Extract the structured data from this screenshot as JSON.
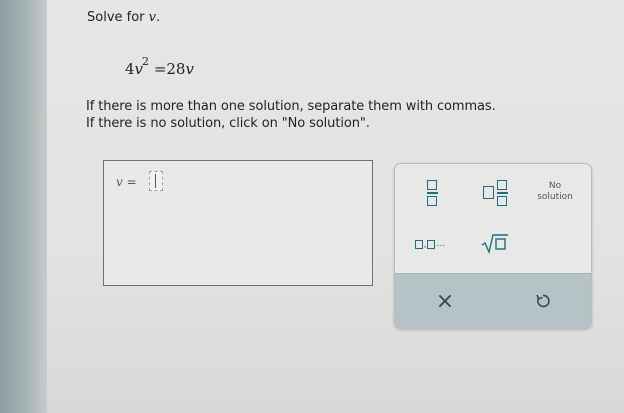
{
  "problem": {
    "prompt_prefix": "Solve for ",
    "variable": "v",
    "prompt_suffix": ".",
    "equation": {
      "coef_left": "4",
      "var_left": "v",
      "exponent": "2",
      "equals": "=",
      "coef_right": "28",
      "var_right": "v"
    }
  },
  "instructions": {
    "line1": "If there is more than one solution, separate them with commas.",
    "line2": "If there is no solution, click on \"No solution\"."
  },
  "answer": {
    "label_var": "v",
    "label_eq": " =",
    "value": ""
  },
  "keypad": {
    "no_solution_line1": "No",
    "no_solution_line2": "solution",
    "list_dots": "...",
    "clear_symbol": "×",
    "icons": [
      "fraction-icon",
      "mixed-number-icon",
      "list-icon",
      "square-root-icon",
      "clear-icon",
      "undo-icon"
    ]
  },
  "colors": {
    "keypad_icon": "#1e6e7e",
    "action_bar": "#b5c3c6"
  }
}
